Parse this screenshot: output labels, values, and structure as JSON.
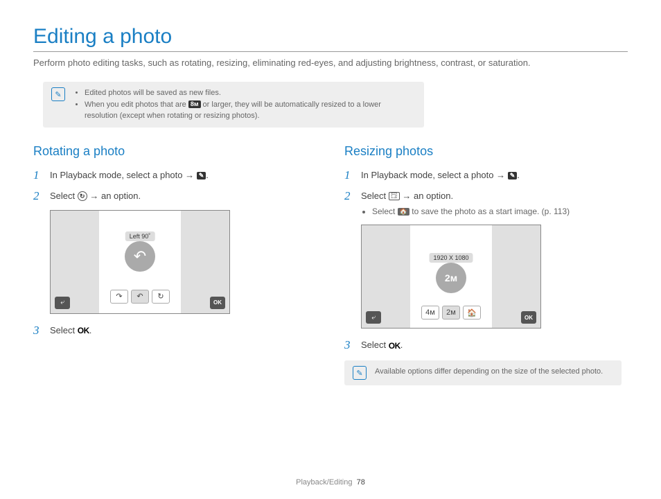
{
  "title": "Editing a photo",
  "intro": "Perform photo editing tasks, such as rotating, resizing, eliminating red-eyes, and adjusting brightness, contrast, or saturation.",
  "notes": {
    "item1": "Edited photos will be saved as new files.",
    "item2_a": "When you edit photos that are ",
    "item2_icon": "8ᴍ",
    "item2_b": " or larger, they will be automatically resized to a lower resolution (except when rotating or resizing photos)."
  },
  "left": {
    "heading": "Rotating a photo",
    "step1_a": "In Playback mode, select a photo →",
    "edit_icon": "✎",
    "step2_a": "Select ",
    "step2_b": " → an option.",
    "rotate_glyph": "↻",
    "step3_a": "Select ",
    "ok_label": "OK",
    "screenshot": {
      "label": "Left 90˚",
      "ok": "OK",
      "btn1": "↷",
      "btn2": "↶",
      "btn3": "↻"
    }
  },
  "right": {
    "heading": "Resizing photos",
    "step1_a": "In Playback mode, select a photo →",
    "edit_icon": "✎",
    "step2_a": "Select ",
    "step2_b": " → an option.",
    "resize_glyph": "⿹",
    "bullet_a": "Select ",
    "bullet_icon": "🏠",
    "bullet_b": " to save the photo as a start image. (p. 113)",
    "step3_a": "Select ",
    "ok_label": "OK",
    "note2": "Available options differ depending on the size of the selected photo.",
    "screenshot": {
      "label": "1920 X 1080",
      "ok": "OK",
      "btn1": "4ᴍ",
      "btn2": "2ᴍ",
      "btn3": "🏠"
    }
  },
  "footer": {
    "section": "Playback/Editing",
    "page": "78"
  }
}
